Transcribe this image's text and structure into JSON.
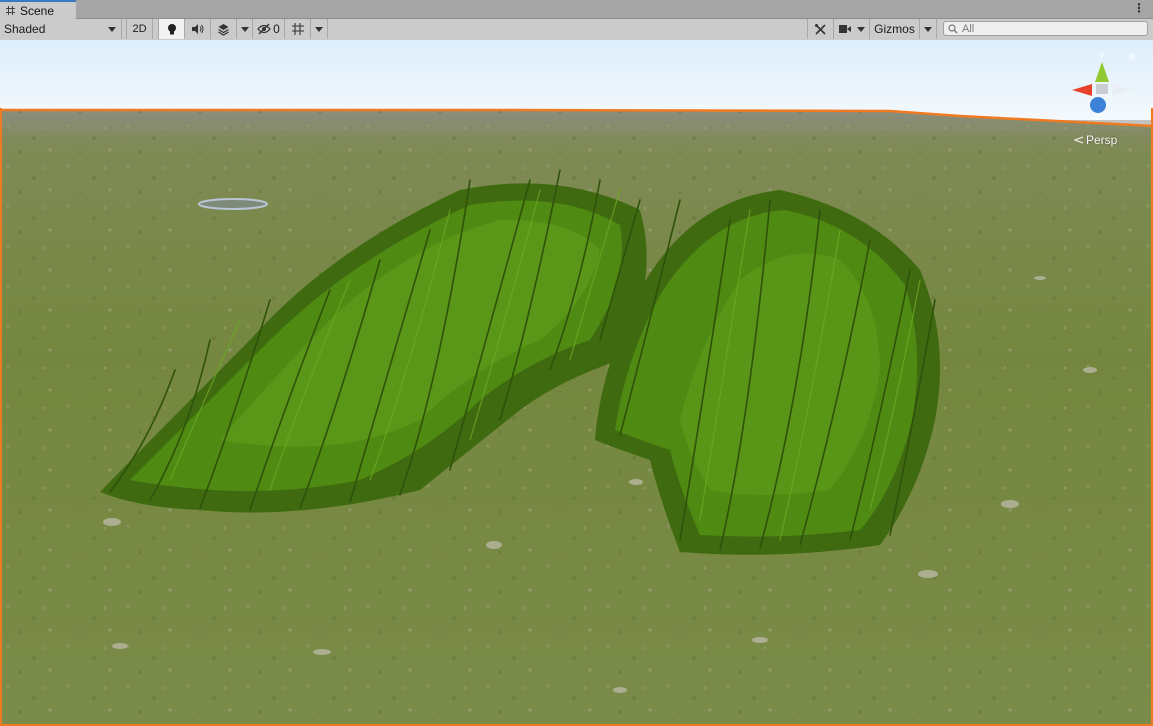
{
  "window": {
    "tab_label": "Scene",
    "tab_icon": "grid-icon",
    "menu_icon": "kebab-menu-icon"
  },
  "toolbar": {
    "shading_mode": "Shaded",
    "mode_2d_label": "2D",
    "hidden_objects_count": "0",
    "gizmos_label": "Gizmos",
    "search_placeholder": "All",
    "icons": [
      "lightbulb-icon",
      "speaker-icon",
      "layers-effects-icon",
      "visibility-toggle-icon",
      "grid-icon",
      "tools-icon",
      "camera-icon",
      "search-icon"
    ]
  },
  "viewport": {
    "projection_label": "Persp",
    "axis_labels": {
      "y": "y",
      "z": "z"
    },
    "colors": {
      "sky_top": "#ddeefb",
      "ground": "#7a8a4a",
      "grass": "#4f8a12",
      "selection_outline": "#f07a22",
      "axis_x": "#e8412c",
      "axis_y": "#8fc92f",
      "axis_z": "#3b82d8"
    }
  }
}
